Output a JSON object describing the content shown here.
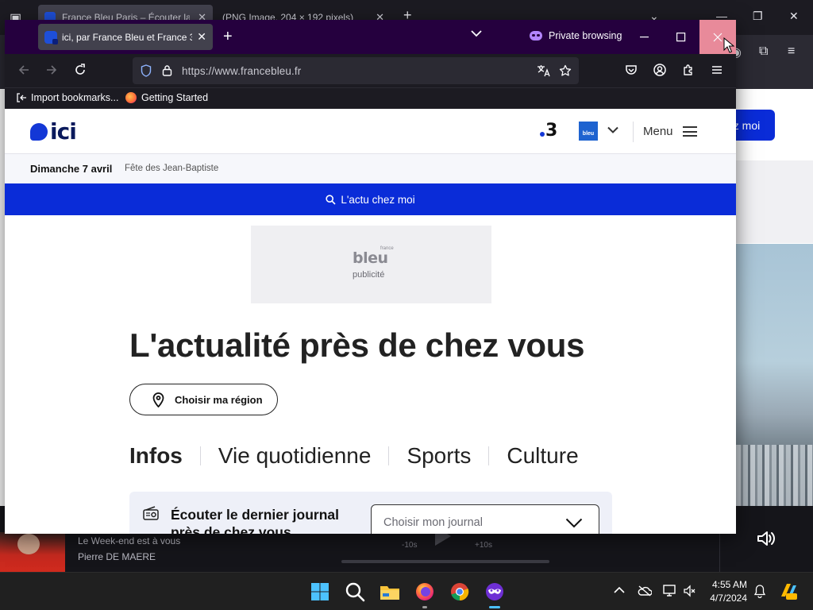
{
  "background_window": {
    "tab1_title": "France Bleu Paris – Écouter la",
    "tab2_title": "(PNG Image, 204 × 192 pixels)",
    "button_partial": "ez moi",
    "player": {
      "line1": "Le Week-end est à vous",
      "line2": "Pierre DE MAERE",
      "back_label": "-10s",
      "forward_label": "+10s"
    }
  },
  "window": {
    "tab_title": "ici, par France Bleu et France 3 -",
    "private_label": "Private browsing",
    "url": "https://www.francebleu.fr",
    "bookmarks": [
      {
        "label": "Import bookmarks...",
        "icon": "import-icon"
      },
      {
        "label": "Getting Started",
        "icon": "firefox-icon"
      }
    ]
  },
  "site": {
    "logo_text": "ici",
    "france3_label": "3",
    "francebleu_badge": "bleu",
    "menu_label": "Menu",
    "date": "Dimanche 7 avril",
    "fete": "Fête des Jean-Baptiste",
    "local_news_label": "L'actu chez moi",
    "ad": {
      "brand": "bleu",
      "brand_small": "france",
      "label": "publicité"
    },
    "headline": "L'actualité près de chez vous",
    "region_button": "Choisir ma région",
    "categories": [
      "Infos",
      "Vie quotidienne",
      "Sports",
      "Culture"
    ],
    "journal": {
      "title": "Écouter le dernier journal près de chez vous",
      "select_placeholder": "Choisir mon journal"
    }
  },
  "taskbar": {
    "time": "4:55 AM",
    "date": "4/7/2024",
    "apps": [
      "start-icon",
      "search-icon",
      "file-explorer-icon",
      "firefox-icon",
      "chrome-icon",
      "firefox-private-icon"
    ]
  },
  "colors": {
    "brand_blue": "#0a2cd8",
    "private_purple": "#25003e",
    "close_hover": "#e88a9a"
  }
}
